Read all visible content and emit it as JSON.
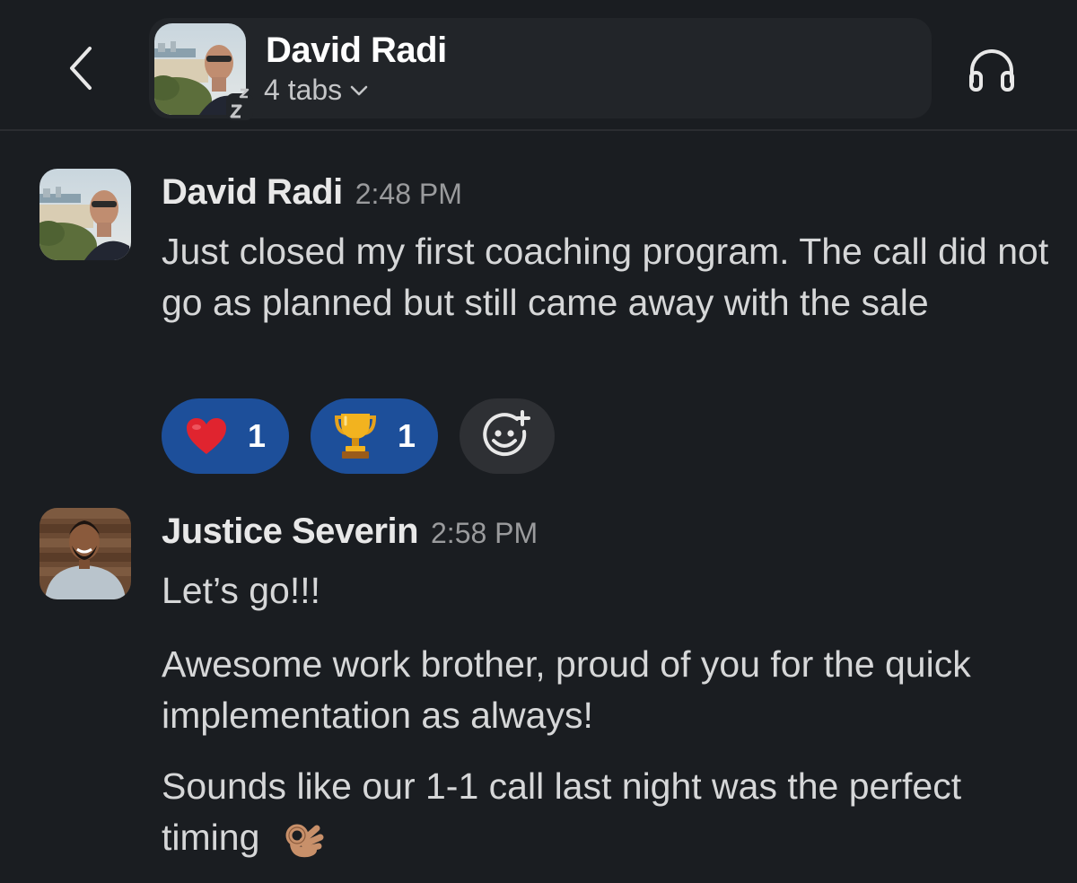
{
  "header": {
    "back_icon": "chevron-left-icon",
    "contact_name": "David Radi",
    "tabs_label": "4 tabs",
    "tabs_chevron": "chevron-down-icon",
    "status_icon": "away-zz-icon",
    "huddle_icon": "headphones-icon"
  },
  "messages": [
    {
      "author": "David Radi",
      "time": "2:48 PM",
      "paragraphs": [
        "Just closed my first coaching program. The call did not go as planned but still came away with the sale"
      ],
      "reactions": [
        {
          "emoji": "heart-icon",
          "count": "1"
        },
        {
          "emoji": "trophy-icon",
          "count": "1"
        }
      ],
      "add_reaction_icon": "add-emoji-icon"
    },
    {
      "author": "Justice Severin",
      "time": "2:58 PM",
      "paragraphs": [
        "Let’s go!!!",
        "Awesome work brother, proud of you for the quick implementation as always!",
        "Sounds like our 1-1 call last night was the perfect timing"
      ],
      "trailing_emoji": "ok-hand-icon"
    }
  ],
  "colors": {
    "background": "#1a1d21",
    "reaction_active": "#1d4f9a",
    "reaction_add": "#2e3034"
  }
}
